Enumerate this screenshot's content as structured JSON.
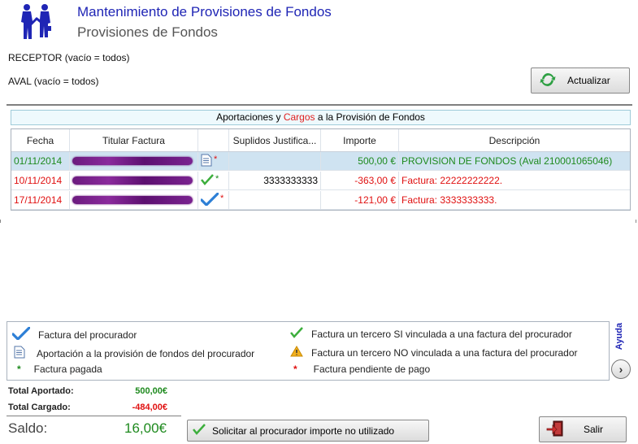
{
  "header": {
    "title": "Mantenimiento de Provisiones de Fondos",
    "subtitle": "Provisiones de Fondos"
  },
  "filters": {
    "receptor_label": "RECEPTOR (vacío = todos)",
    "aval_label": "AVAL (vacío = todos)"
  },
  "toolbar": {
    "update_label": "Actualizar"
  },
  "table": {
    "caption_part1": "Aportaciones y",
    "caption_cargos": "Cargos",
    "caption_part2": "a la Provisión de Fondos",
    "columns": [
      "Fecha",
      "Titular Factura",
      "",
      "Suplidos Justifica...",
      "Importe",
      "Descripción"
    ],
    "rows": [
      {
        "fecha": "01/11/2014",
        "icon": "document-icon",
        "star": "*",
        "suplidos": "",
        "importe": "500,00 €",
        "descripcion": "PROVISION DE FONDOS (Aval 210001065046)",
        "color": "#1e8a1e"
      },
      {
        "fecha": "10/11/2014",
        "icon": "green-check-icon",
        "star": "*",
        "suplidos": "3333333333",
        "importe": "-363,00 €",
        "descripcion": "Factura: 22222222222.",
        "color": "#e01010"
      },
      {
        "fecha": "17/11/2014",
        "icon": "blue-check-icon",
        "star": "*",
        "suplidos": "",
        "importe": "-121,00 €",
        "descripcion": "Factura: 3333333333.",
        "color": "#e01010"
      }
    ]
  },
  "legend": {
    "factura_procurador": "Factura del procurador",
    "aportacion": "Aportación a la provisión de fondos del procurador",
    "pagada": "Factura pagada",
    "tercero_si": "Factura un tercero SI vinculada a una factura del procurador",
    "tercero_no": "Factura un tercero NO vinculada a una factura del procurador",
    "pendiente": "Factura pendiente de pago",
    "star": "*",
    "help_label": "Ayuda"
  },
  "totals": {
    "aportado_label": "Total Aportado:",
    "aportado_value": "500,00€",
    "cargado_label": "Total Cargado:",
    "cargado_value": "-484,00€",
    "saldo_label": "Saldo:",
    "saldo_value": "16,00€"
  },
  "actions": {
    "solicitar_label": "Solicitar al procurador importe no utilizado",
    "salir_label": "Salir"
  },
  "colors": {
    "title_blue": "#1f25b5",
    "positive_green": "#1e8a1e",
    "negative_red": "#e01010",
    "selected_row": "#cfe3f1"
  }
}
